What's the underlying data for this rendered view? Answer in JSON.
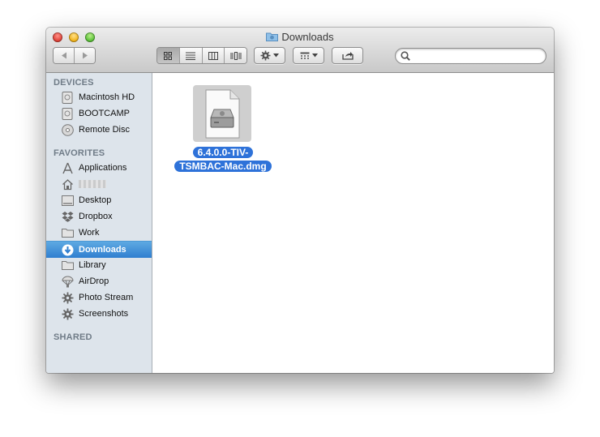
{
  "window": {
    "title": "Downloads"
  },
  "toolbar": {
    "search": {
      "placeholder": "",
      "value": ""
    }
  },
  "sidebar": {
    "devices_header": "DEVICES",
    "devices": [
      {
        "label": "Macintosh HD",
        "icon": "hard-drive-icon"
      },
      {
        "label": "BOOTCAMP",
        "icon": "hard-drive-icon"
      },
      {
        "label": "Remote Disc",
        "icon": "disc-icon"
      }
    ],
    "favorites_header": "FAVORITES",
    "favorites": [
      {
        "label": "Applications",
        "icon": "applications-icon"
      },
      {
        "label": "",
        "icon": "home-icon"
      },
      {
        "label": "Desktop",
        "icon": "desktop-icon"
      },
      {
        "label": "Dropbox",
        "icon": "dropbox-icon"
      },
      {
        "label": "Work",
        "icon": "folder-icon"
      },
      {
        "label": "Downloads",
        "icon": "downloads-icon",
        "selected": true
      },
      {
        "label": "Library",
        "icon": "folder-icon"
      },
      {
        "label": "AirDrop",
        "icon": "airdrop-icon"
      },
      {
        "label": "Photo Stream",
        "icon": "gear-icon"
      },
      {
        "label": "Screenshots",
        "icon": "gear-icon"
      }
    ],
    "shared_header": "SHARED"
  },
  "files": [
    {
      "name_line1": "6.4.0.0-TIV-",
      "name_line2": "TSMBAC-Mac.dmg",
      "icon": "disk-image-icon",
      "selected": true
    }
  ],
  "colors": {
    "selection": "#2e72d9",
    "sidebar_bg": "#dde4eb",
    "sidebar_header": "#6f7b87"
  }
}
